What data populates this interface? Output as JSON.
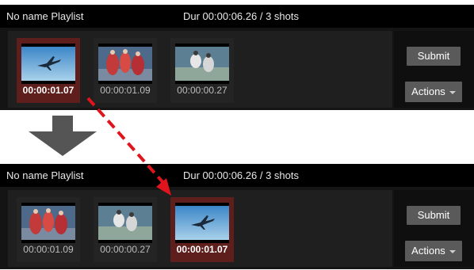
{
  "before": {
    "header": {
      "title": "No name Playlist",
      "duration": "Dur 00:00:06.26 / 3 shots"
    },
    "shots": [
      {
        "time": "00:00:01.07",
        "thumbnail": "plane-thumbnail",
        "selected": true
      },
      {
        "time": "00:00:01.09",
        "thumbnail": "dancers-thumbnail",
        "selected": false
      },
      {
        "time": "00:00:00.27",
        "thumbnail": "figures-thumbnail",
        "selected": false
      }
    ],
    "buttons": {
      "submit": "Submit",
      "actions": "Actions"
    }
  },
  "after": {
    "header": {
      "title": "No name Playlist",
      "duration": "Dur 00:00:06.26 / 3 shots"
    },
    "shots": [
      {
        "time": "00:00:01.09",
        "thumbnail": "dancers-thumbnail",
        "selected": false
      },
      {
        "time": "00:00:00.27",
        "thumbnail": "figures-thumbnail",
        "selected": false
      },
      {
        "time": "00:00:01.07",
        "thumbnail": "plane-thumbnail",
        "selected": true
      }
    ],
    "buttons": {
      "submit": "Submit",
      "actions": "Actions"
    }
  },
  "colors": {
    "selected_tile": "#5e1f1c",
    "drag_arrow": "#e0141c",
    "step_arrow": "#555555"
  }
}
